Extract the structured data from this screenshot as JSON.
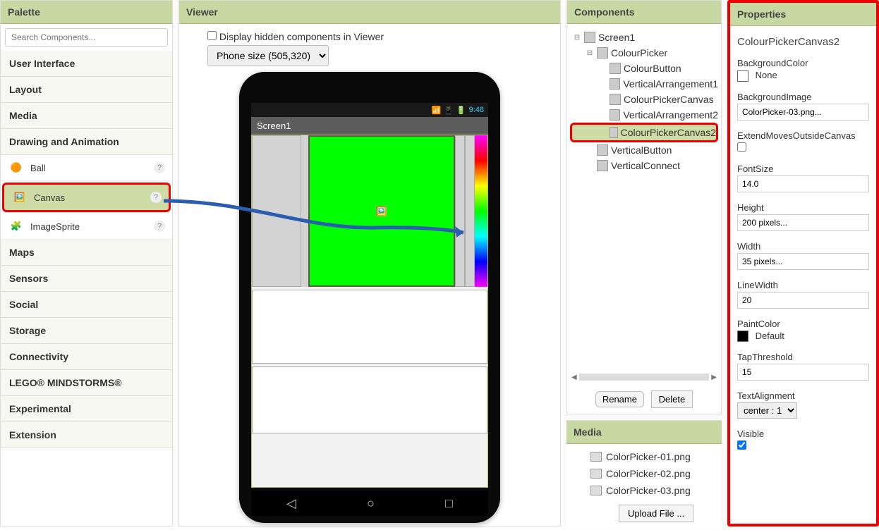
{
  "palette": {
    "header": "Palette",
    "search_placeholder": "Search Components...",
    "categories": [
      "User Interface",
      "Layout",
      "Media",
      "Drawing and Animation",
      "Maps",
      "Sensors",
      "Social",
      "Storage",
      "Connectivity",
      "LEGO® MINDSTORMS®",
      "Experimental",
      "Extension"
    ],
    "drawer_items": [
      {
        "label": "Ball",
        "icon": "ball-icon"
      },
      {
        "label": "Canvas",
        "icon": "canvas-icon",
        "selected": true
      },
      {
        "label": "ImageSprite",
        "icon": "sprite-icon"
      }
    ]
  },
  "viewer": {
    "header": "Viewer",
    "display_hidden_label": "Display hidden components in Viewer",
    "phone_size_label": "Phone size (505,320)",
    "status_time": "9:48",
    "screen_title": "Screen1"
  },
  "components": {
    "header": "Components",
    "tree": [
      {
        "label": "Screen1",
        "depth": 0,
        "expand": "⊟",
        "icon": "screen"
      },
      {
        "label": "ColourPicker",
        "depth": 1,
        "expand": "⊟",
        "icon": "layout"
      },
      {
        "label": "ColourButton",
        "depth": 2,
        "icon": "button"
      },
      {
        "label": "VerticalArrangement1",
        "depth": 2,
        "icon": "layout"
      },
      {
        "label": "ColourPickerCanvas",
        "depth": 2,
        "icon": "canvas"
      },
      {
        "label": "VerticalArrangement2",
        "depth": 2,
        "icon": "layout"
      },
      {
        "label": "ColourPickerCanvas2",
        "depth": 2,
        "icon": "canvas",
        "selected": true
      },
      {
        "label": "VerticalButton",
        "depth": 1,
        "icon": "layout"
      },
      {
        "label": "VerticalConnect",
        "depth": 1,
        "icon": "layout"
      }
    ],
    "rename_btn": "Rename",
    "delete_btn": "Delete"
  },
  "media": {
    "header": "Media",
    "files": [
      "ColorPicker-01.png",
      "ColorPicker-02.png",
      "ColorPicker-03.png"
    ],
    "upload_btn": "Upload File ..."
  },
  "properties": {
    "header": "Properties",
    "component_name": "ColourPickerCanvas2",
    "props": {
      "BackgroundColor_label": "BackgroundColor",
      "BackgroundColor_value": "None",
      "BackgroundImage_label": "BackgroundImage",
      "BackgroundImage_value": "ColorPicker-03.png...",
      "ExtendMoves_label": "ExtendMovesOutsideCanvas",
      "FontSize_label": "FontSize",
      "FontSize_value": "14.0",
      "Height_label": "Height",
      "Height_value": "200 pixels...",
      "Width_label": "Width",
      "Width_value": "35 pixels...",
      "LineWidth_label": "LineWidth",
      "LineWidth_value": "20",
      "PaintColor_label": "PaintColor",
      "PaintColor_value": "Default",
      "TapThreshold_label": "TapThreshold",
      "TapThreshold_value": "15",
      "TextAlignment_label": "TextAlignment",
      "TextAlignment_value": "center : 1",
      "Visible_label": "Visible"
    }
  }
}
